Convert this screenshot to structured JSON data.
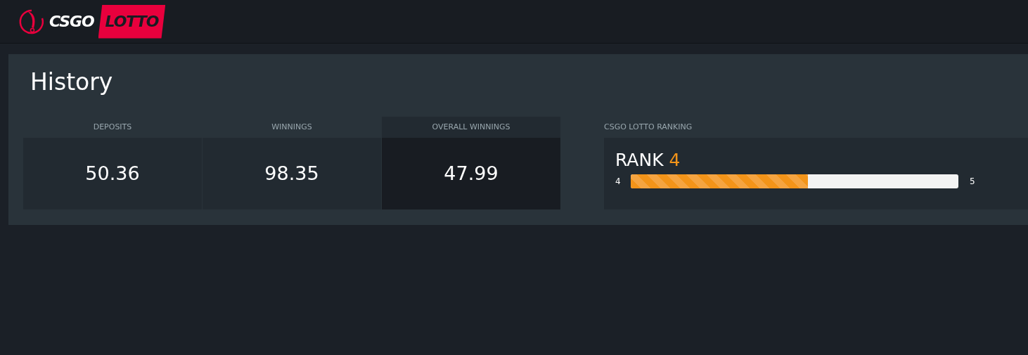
{
  "header": {
    "logo": {
      "word_1": "CSGO",
      "word_2": "LOTTO"
    }
  },
  "history": {
    "title": "History",
    "stats": [
      {
        "label": "DEPOSITS",
        "value": "50.36",
        "selected": false
      },
      {
        "label": "WINNINGS",
        "value": "98.35",
        "selected": false
      },
      {
        "label": "OVERALL WINNINGS",
        "value": "47.99",
        "selected": true
      }
    ],
    "ranking": {
      "label": "CSGO LOTTO RANKING",
      "rank_word": "RANK",
      "rank": "4",
      "from": "4",
      "to": "5",
      "level": 0.54
    }
  }
}
